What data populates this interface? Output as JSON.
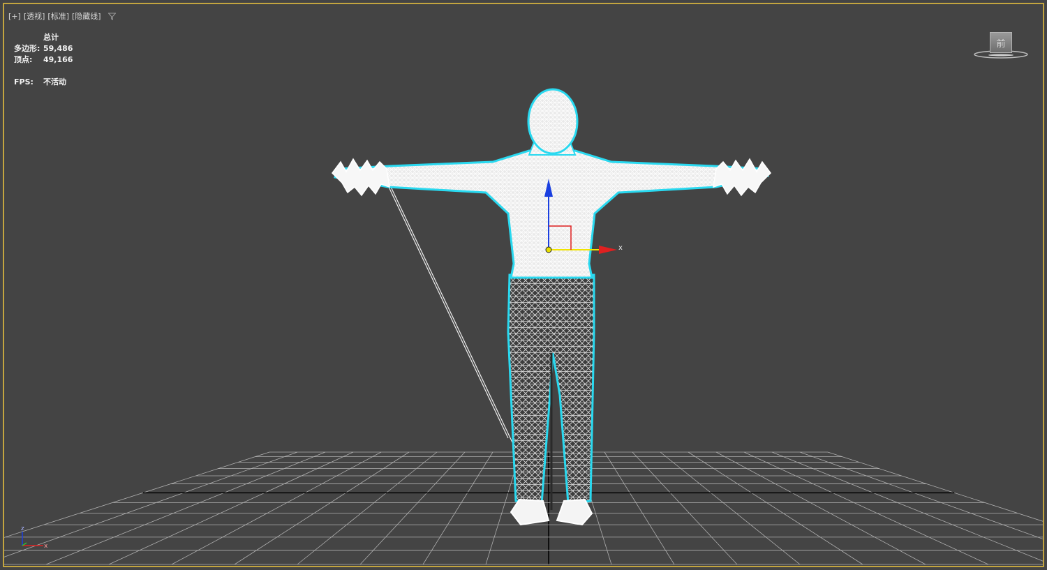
{
  "viewport": {
    "labels": {
      "plus": "[+]",
      "view": "[透视]",
      "shading": "[标准]",
      "mode": "[隐藏线]"
    },
    "stats": {
      "header": "总计",
      "polygons_label": "多边形:",
      "polygons_value": "59,486",
      "vertices_label": "顶点:",
      "vertices_value": "49,166",
      "fps_label": "FPS:",
      "fps_value": "不活动"
    },
    "viewcube_face": "前",
    "gizmo_x_label": "x",
    "tripod": {
      "z_label": "z",
      "x_label": "x"
    }
  },
  "colors": {
    "background": "#444444",
    "border_active": "#c3a53f",
    "grid_line": "#b0b0b0",
    "grid_axis": "#000000",
    "mesh_wire": "#ffffff",
    "selection_outline": "#29d9f0",
    "gizmo_x": "#e02020",
    "gizmo_y": "#f2e400",
    "gizmo_z": "#1a3fe0"
  }
}
